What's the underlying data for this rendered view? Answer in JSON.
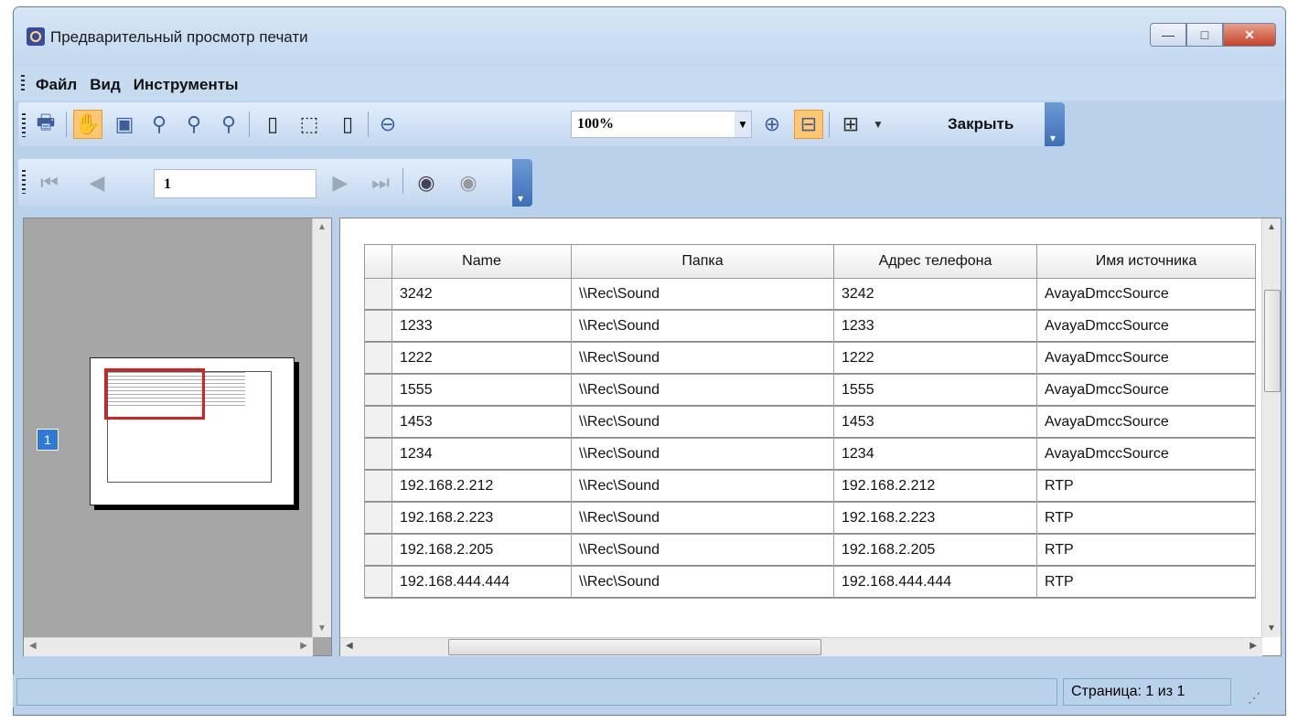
{
  "window": {
    "title": "Предварительный просмотр печати",
    "buttons": {
      "minimize": "—",
      "maximize": "□",
      "close": "✕"
    }
  },
  "menu": [
    "Файл",
    "Вид",
    "Инструменты"
  ],
  "toolbar": {
    "zoom_value": "100%",
    "close_label": "Закрыть"
  },
  "nav": {
    "page_value": "1"
  },
  "thumbnail": {
    "page_number": "1"
  },
  "table": {
    "columns": [
      "Name",
      "Папка",
      "Адрес телефона",
      "Имя источника"
    ],
    "rows": [
      [
        "3242",
        "\\\\Rec\\Sound",
        "3242",
        "AvayaDmccSource"
      ],
      [
        "1233",
        "\\\\Rec\\Sound",
        "1233",
        "AvayaDmccSource"
      ],
      [
        "1222",
        "\\\\Rec\\Sound",
        "1222",
        "AvayaDmccSource"
      ],
      [
        "1555",
        "\\\\Rec\\Sound",
        "1555",
        "AvayaDmccSource"
      ],
      [
        "1453",
        "\\\\Rec\\Sound",
        "1453",
        "AvayaDmccSource"
      ],
      [
        "1234",
        "\\\\Rec\\Sound",
        "1234",
        "AvayaDmccSource"
      ],
      [
        "192.168.2.212",
        "\\\\Rec\\Sound",
        "192.168.2.212",
        "RTP"
      ],
      [
        "192.168.2.223",
        "\\\\Rec\\Sound",
        "192.168.2.223",
        "RTP"
      ],
      [
        "192.168.2.205",
        "\\\\Rec\\Sound",
        "192.168.2.205",
        "RTP"
      ],
      [
        "192.168.444.444",
        "\\\\Rec\\Sound",
        "192.168.444.444",
        "RTP"
      ]
    ]
  },
  "status": {
    "page_info": "Страница: 1 из 1"
  }
}
